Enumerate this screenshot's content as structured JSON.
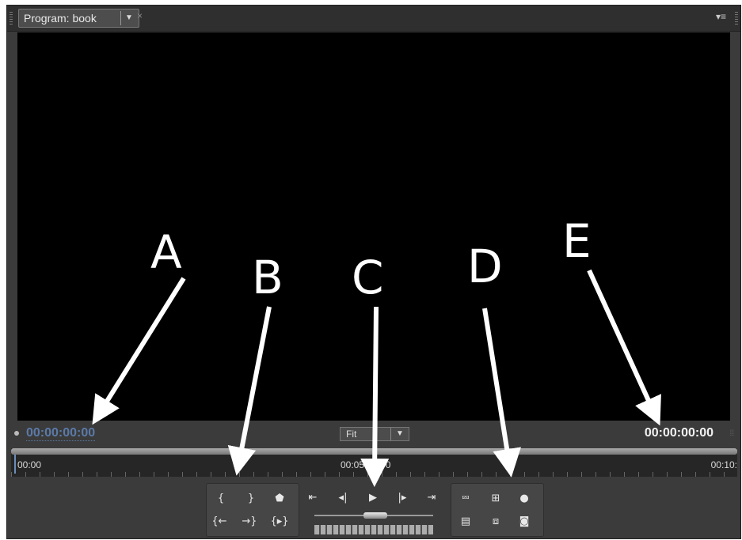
{
  "tab": {
    "title": "Program: book",
    "dropdown_icon": "chevron-down-icon",
    "close_icon": "close-icon"
  },
  "panel_menu_icon": "panel-menu-icon",
  "annotations": [
    "A",
    "B",
    "C",
    "D",
    "E"
  ],
  "timecode": {
    "playhead": "00:00:00:00",
    "duration": "00:00:00:00"
  },
  "zoom": {
    "value": "Fit"
  },
  "ruler": {
    "start": "00:00",
    "middle": "00:05:00:00",
    "end": "00:10:"
  },
  "controls": {
    "group_b": [
      "mark-in-icon",
      "mark-out-icon",
      "set-marker-icon",
      "go-to-in-icon",
      "go-to-out-icon",
      "play-in-to-out-icon"
    ],
    "group_c": [
      "go-to-previous-edit-icon",
      "step-back-icon",
      "play-icon",
      "step-forward-icon",
      "go-to-next-edit-icon"
    ],
    "group_d": [
      "safe-margins-icon",
      "output-icon",
      "lift-icon",
      "extract-icon",
      "export-frame-icon",
      "trim-icon"
    ]
  },
  "colors": {
    "panel": "#3b3b3b",
    "viewer": "#000000",
    "timecode_link": "#5b7aa8",
    "timecode_total": "#f2f2f2"
  }
}
